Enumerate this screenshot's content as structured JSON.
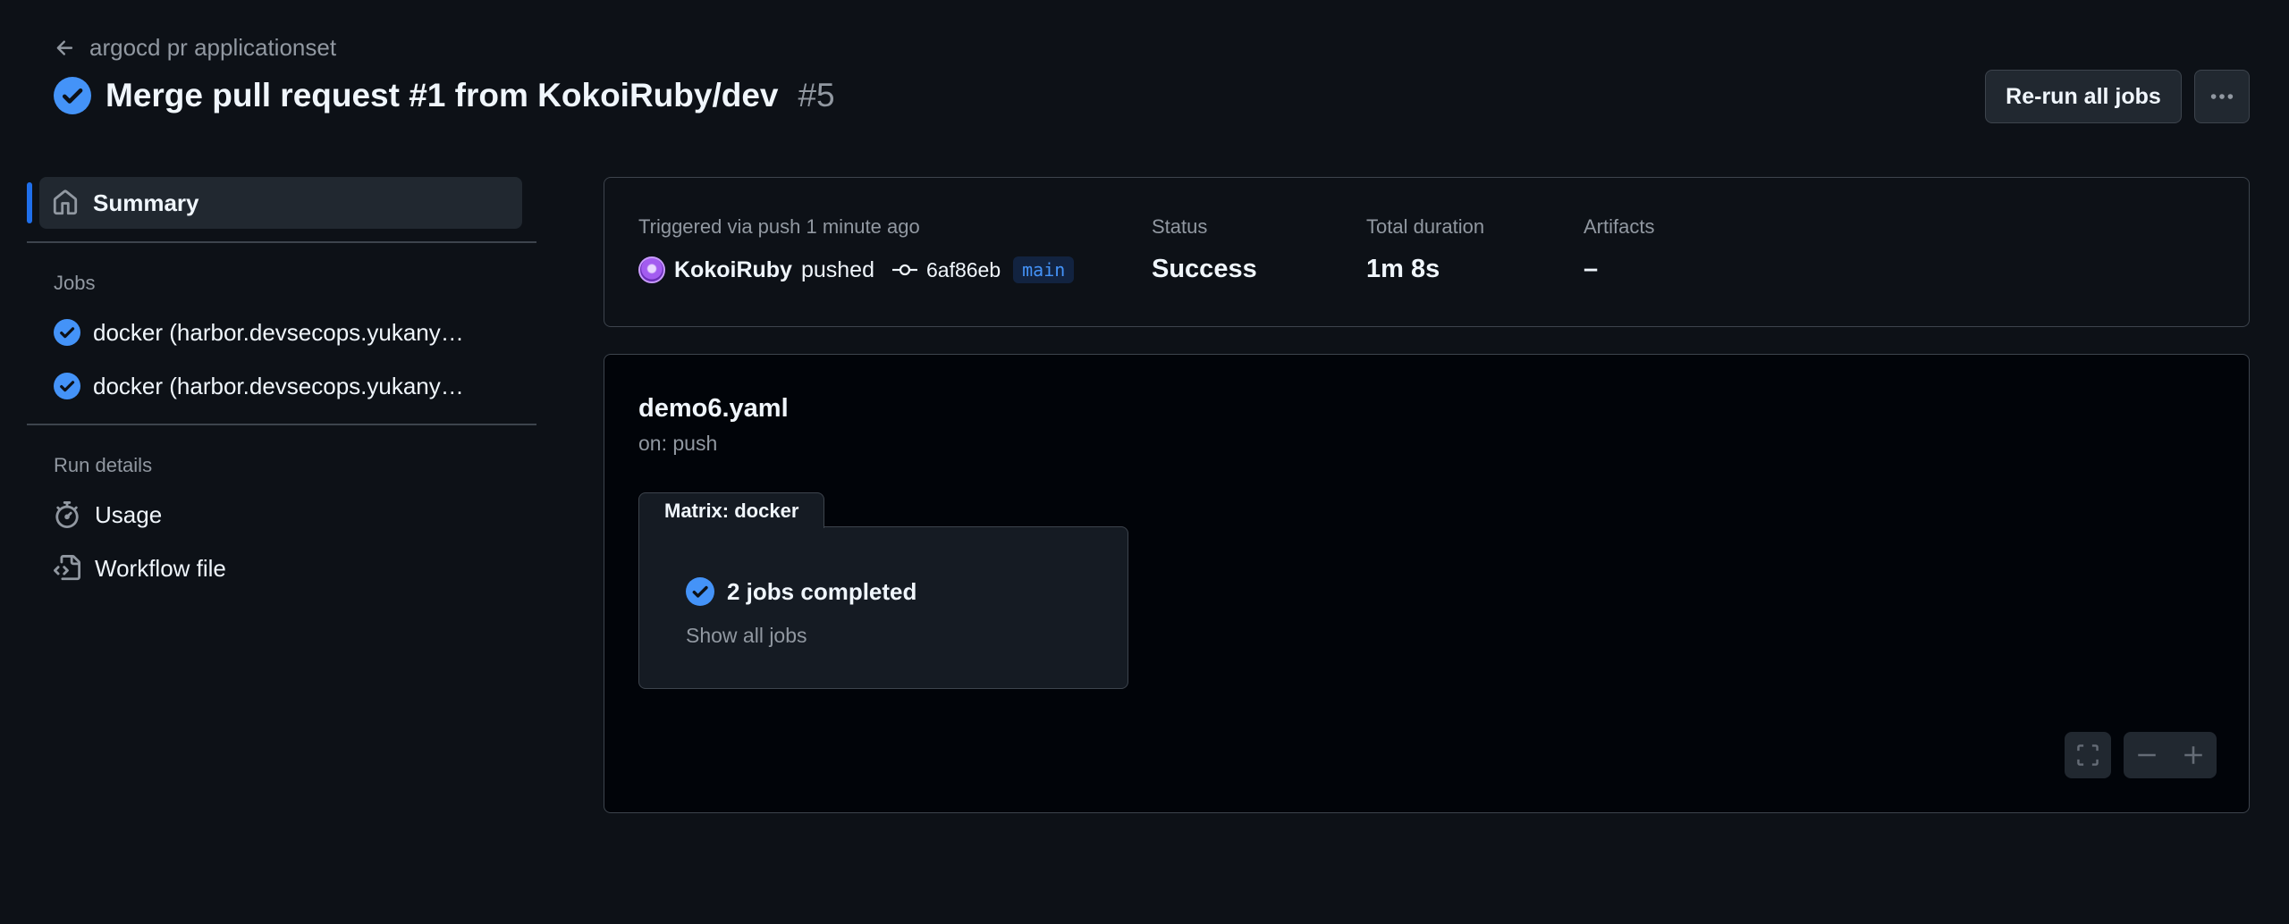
{
  "header": {
    "back_label": "argocd pr applicationset",
    "title": "Merge pull request #1 from KokoiRuby/dev",
    "run_number": "#5",
    "rerun_label": "Re-run all jobs",
    "more_icon": "kebab-horizontal-icon"
  },
  "sidebar": {
    "summary_label": "Summary",
    "jobs_heading": "Jobs",
    "jobs": [
      {
        "label": "docker (harbor.devsecops.yukany…",
        "status": "success"
      },
      {
        "label": "docker (harbor.devsecops.yukany…",
        "status": "success"
      }
    ],
    "run_details_heading": "Run details",
    "run_details": [
      {
        "label": "Usage",
        "icon": "stopwatch-icon"
      },
      {
        "label": "Workflow file",
        "icon": "file-code-icon"
      }
    ]
  },
  "summary": {
    "trigger_label": "Triggered via push 1 minute ago",
    "actor": "KokoiRuby",
    "action": "pushed",
    "commit_sha": "6af86eb",
    "branch": "main",
    "status_label": "Status",
    "status_value": "Success",
    "duration_label": "Total duration",
    "duration_value": "1m 8s",
    "artifacts_label": "Artifacts",
    "artifacts_value": "–"
  },
  "workflow": {
    "file_name": "demo6.yaml",
    "trigger": "on: push",
    "matrix_label": "Matrix: docker",
    "matrix_status": "2 jobs completed",
    "show_all_label": "Show all jobs"
  },
  "colors": {
    "background": "#0d1117",
    "graph_background": "#010409",
    "success": "#4493f8",
    "accent_bar": "#1f6feb",
    "border": "#3d444d",
    "muted_text": "#9198a1"
  }
}
